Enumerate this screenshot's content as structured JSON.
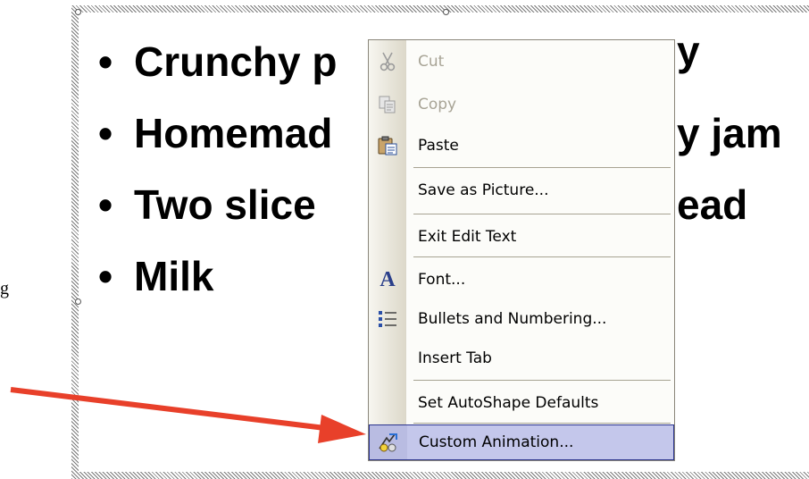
{
  "slide": {
    "bullets": [
      {
        "text": "Crunchy p"
      },
      {
        "text": "Homemad"
      },
      {
        "text": "Two slice"
      },
      {
        "text": "Milk"
      }
    ],
    "bullet_suffixes": [
      {
        "text": "y"
      },
      {
        "text": "y jam"
      },
      {
        "text": "ead"
      }
    ],
    "stray_char": "g"
  },
  "context_menu": {
    "items": [
      {
        "name": "cut",
        "label": "Cut",
        "icon": "scissors-icon",
        "enabled": false
      },
      {
        "name": "copy",
        "label": "Copy",
        "icon": "copy-icon",
        "enabled": false
      },
      {
        "name": "paste",
        "label": "Paste",
        "icon": "clipboard-icon",
        "enabled": true
      },
      {
        "name": "save-as-picture",
        "label": "Save as Picture...",
        "icon": "",
        "enabled": true
      },
      {
        "name": "exit-edit-text",
        "label": "Exit Edit Text",
        "icon": "",
        "enabled": true
      },
      {
        "name": "font",
        "label": "Font...",
        "icon": "font-icon",
        "enabled": true
      },
      {
        "name": "bullets-and-numbering",
        "label": "Bullets and Numbering...",
        "icon": "bullets-icon",
        "enabled": true
      },
      {
        "name": "insert-tab",
        "label": "Insert Tab",
        "icon": "",
        "enabled": true
      },
      {
        "name": "set-autoshape-defaults",
        "label": "Set AutoShape Defaults",
        "icon": "",
        "enabled": true
      },
      {
        "name": "custom-animation",
        "label": "Custom Animation...",
        "icon": "animation-icon",
        "enabled": true,
        "highlighted": true
      }
    ]
  },
  "colors": {
    "arrow": "#e8402a",
    "highlight": "#c4c7eb",
    "disabled_text": "#a8a496"
  }
}
